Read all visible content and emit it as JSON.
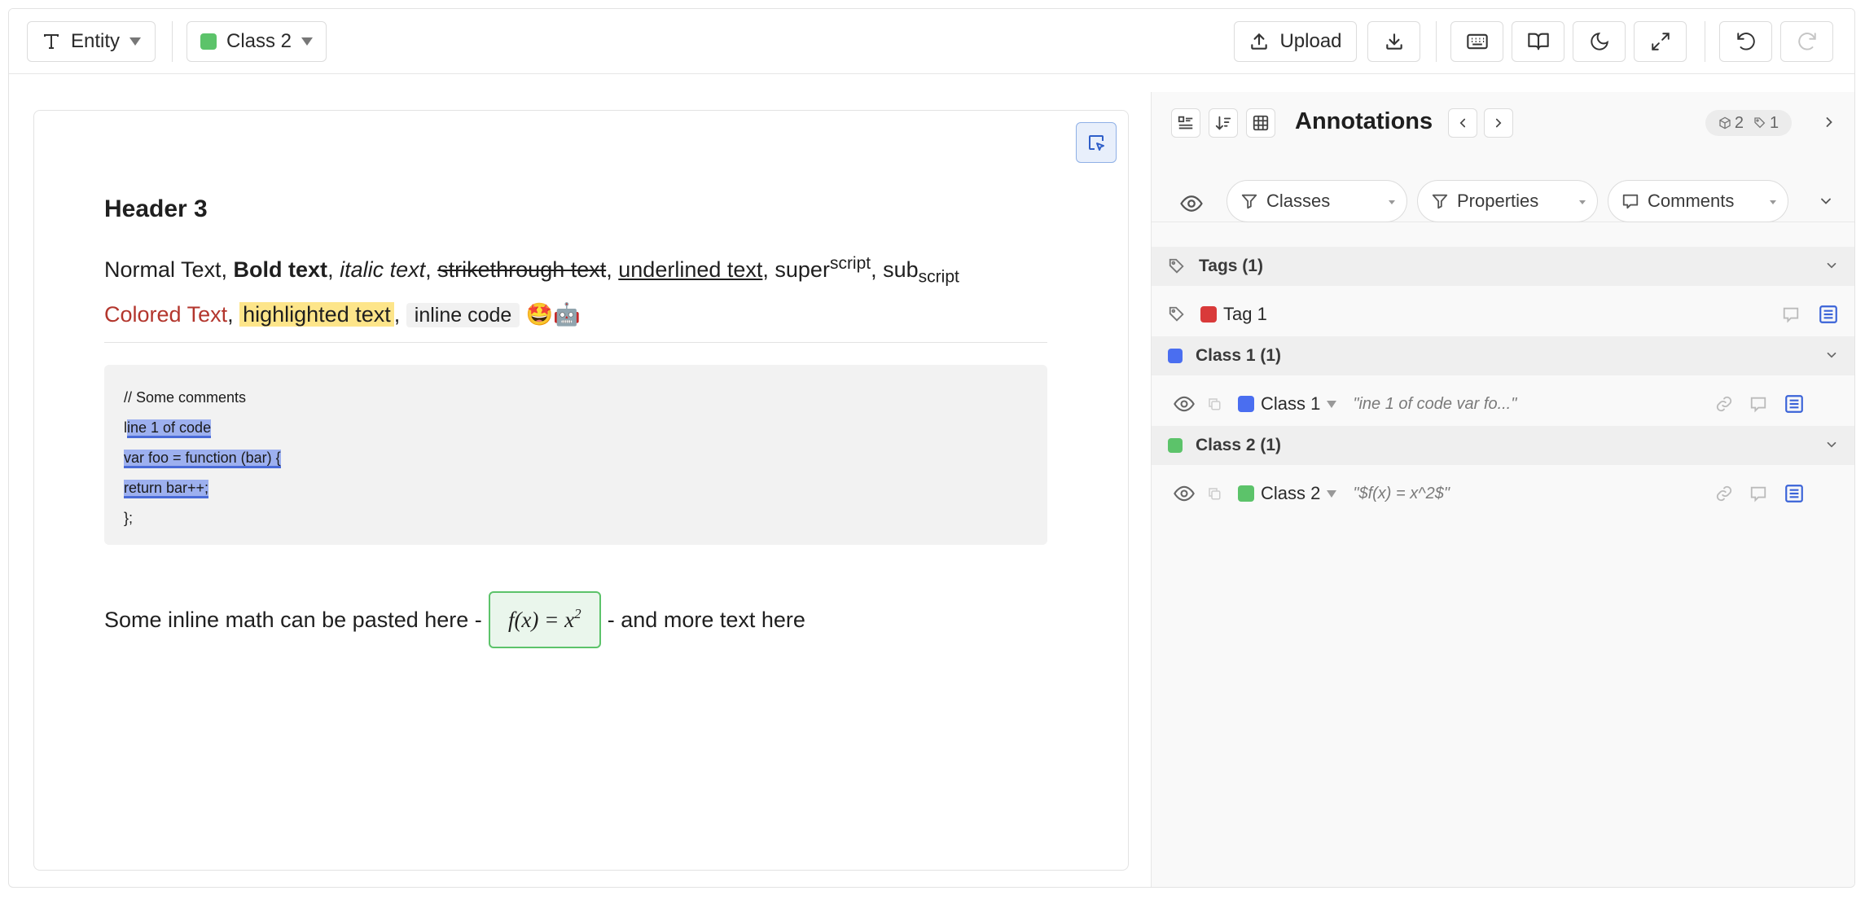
{
  "toolbar": {
    "mode_label": "Entity",
    "class_label": "Class 2",
    "class_color": "#5cc36a",
    "upload_label": "Upload"
  },
  "editor": {
    "header": "Header 3",
    "para": {
      "normal": "Normal Text, ",
      "bold": "Bold text",
      "sep1": ", ",
      "italic": "italic text",
      "sep2": ", ",
      "strike": "strikethrough text",
      "sep3": ", ",
      "underline": "underlined text",
      "sep4": ", super",
      "sup": "script",
      "sep5": ", sub",
      "sub": "script",
      "colored": "Colored Text",
      "sep6": ", ",
      "highlighted": "highlighted text",
      "sep7": ", ",
      "inline_code": "inline code",
      "emoji": "🤩🤖"
    },
    "code": {
      "line1": "// Some comments",
      "line2_pre": "l",
      "line2_mark": "ine 1 of code",
      "line3": "var foo = function (bar) {",
      "line4": "return bar++;",
      "line5": "};"
    },
    "math": {
      "pre": "Some inline math can be pasted here -",
      "formula": "f(x) = x",
      "exponent": "2",
      "post": "- and more text here"
    }
  },
  "panel": {
    "title": "Annotations",
    "count_entities": "2",
    "count_tags": "1",
    "filters": {
      "classes": "Classes",
      "properties": "Properties",
      "comments": "Comments"
    },
    "tags_group": "Tags (1)",
    "tag1": {
      "label": "Tag 1",
      "color": "#d93a3a"
    },
    "class1_group": {
      "label": "Class 1 (1)",
      "color": "#4a6ef0"
    },
    "class1_item": {
      "label": "Class 1",
      "snippet": "\"ine 1 of code var fo...\""
    },
    "class2_group": {
      "label": "Class 2 (1)",
      "color": "#5cc36a"
    },
    "class2_item": {
      "label": "Class 2",
      "snippet": "\"$f(x) = x^2$\""
    }
  }
}
